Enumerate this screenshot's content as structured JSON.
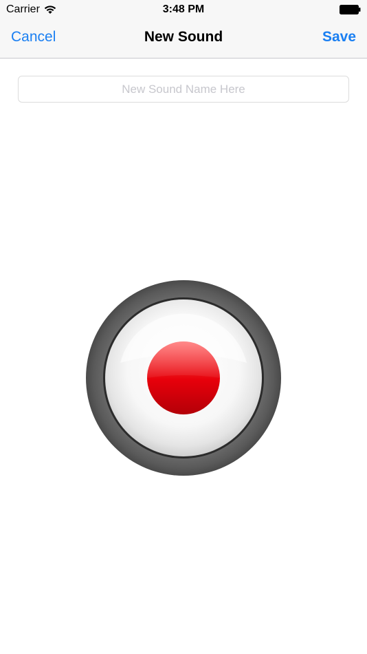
{
  "status_bar": {
    "carrier": "Carrier",
    "time": "3:48 PM",
    "icons": {
      "wifi": "wifi-icon",
      "battery": "battery-icon"
    }
  },
  "nav_bar": {
    "cancel_label": "Cancel",
    "title": "New Sound",
    "save_label": "Save"
  },
  "sound_name": {
    "value": "",
    "placeholder": "New Sound Name Here"
  },
  "record": {
    "icon": "record-icon"
  },
  "colors": {
    "accent": "#1a7ff2",
    "bar_background": "#f7f7f7",
    "record_red": "#e8000b",
    "ring_gray": "#5e5e5e"
  }
}
